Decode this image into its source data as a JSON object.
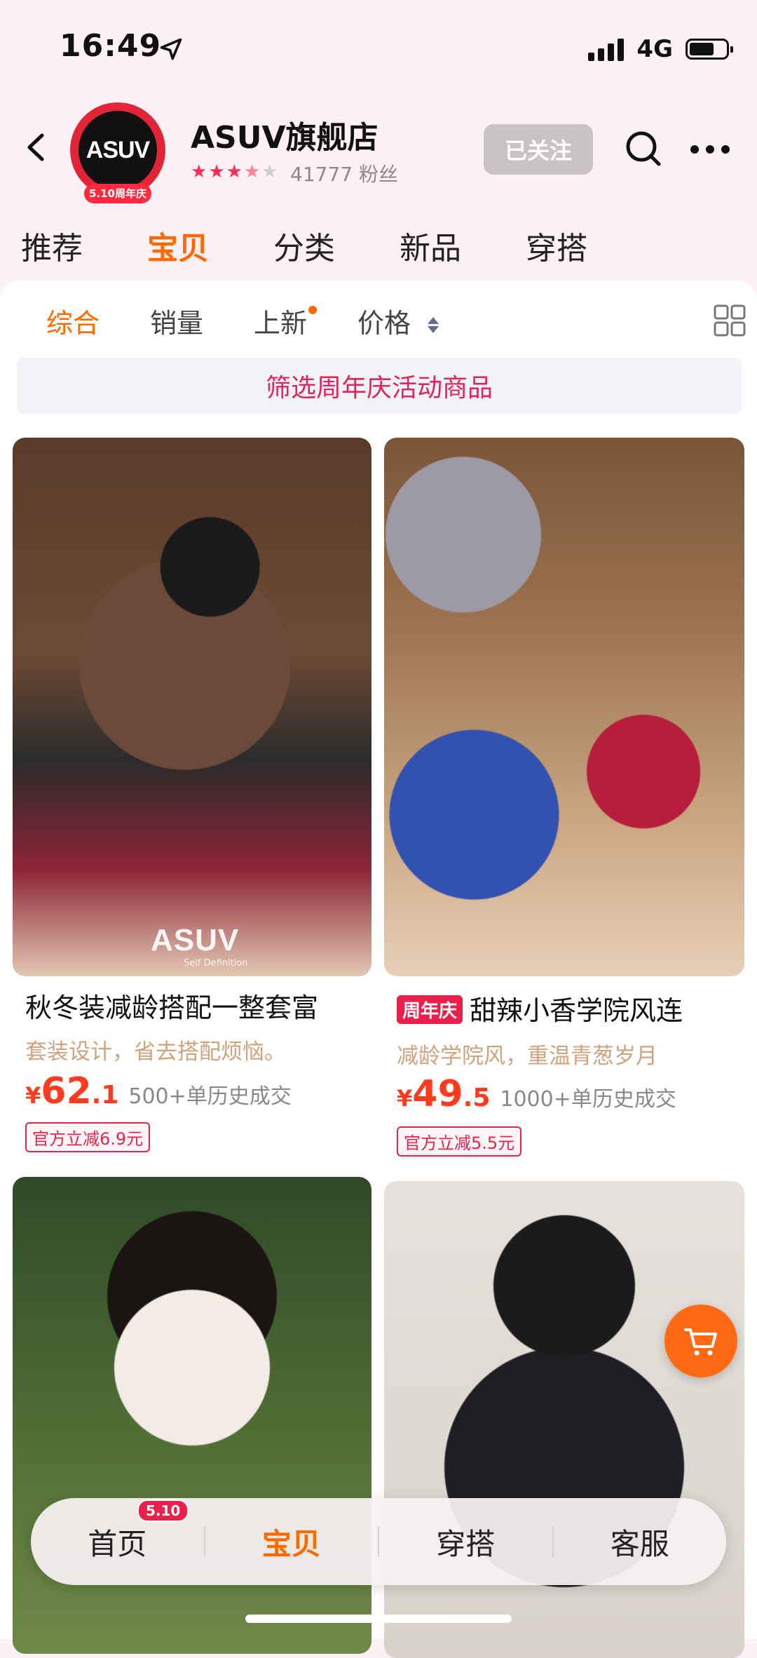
{
  "status_bar": {
    "time": "16:49",
    "network": "4G"
  },
  "store": {
    "logo_text": "ASUV",
    "logo_badge": "5.10周年庆",
    "name": "ASUV旗舰店",
    "fans": "41777 粉丝",
    "follow_label": "已关注"
  },
  "main_tabs": [
    {
      "label": "推荐"
    },
    {
      "label": "宝贝"
    },
    {
      "label": "分类"
    },
    {
      "label": "新品"
    },
    {
      "label": "穿搭"
    }
  ],
  "sort_bar": {
    "items": [
      {
        "label": "综合"
      },
      {
        "label": "销量"
      },
      {
        "label": "上新"
      },
      {
        "label": "价格"
      }
    ]
  },
  "filter_banner": "筛选周年庆活动商品",
  "products": [
    {
      "watermark": "ASUV",
      "watermark_sub": "Self Definition",
      "title": "秋冬装减龄搭配一整套富",
      "subtitle": "套装设计，省去搭配烦恼。",
      "price_currency": "¥",
      "price_int": "62",
      "price_dec": ".1",
      "sold": "500+单历史成交",
      "coupon": "官方立减6.9元"
    },
    {
      "badge": "周年庆",
      "title": "甜辣小香学院风连",
      "subtitle": "减龄学院风，重温青葱岁月",
      "price_currency": "¥",
      "price_int": "49",
      "price_dec": ".5",
      "sold": "1000+单历史成交",
      "coupon": "官方立减5.5元"
    }
  ],
  "bottom_nav": {
    "items": [
      {
        "label": "首页",
        "badge": "5.10"
      },
      {
        "label": "宝贝"
      },
      {
        "label": "穿搭"
      },
      {
        "label": "客服"
      }
    ]
  },
  "colors": {
    "accent": "#ff6a00",
    "price": "#ff3b1f",
    "brand_red": "#e8204a"
  }
}
